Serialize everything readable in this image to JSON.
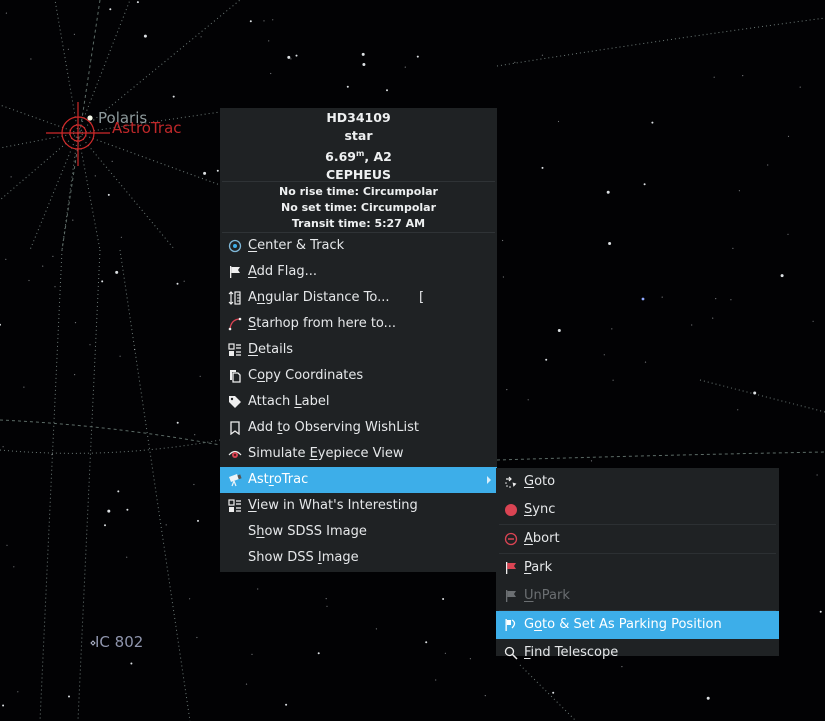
{
  "sky": {
    "labels": {
      "polaris": "Polaris",
      "telescope": "AstroTrac",
      "ic802": "IC 802"
    },
    "colors": {
      "background": "#020204",
      "telescope_reticle": "#d02a2a",
      "grid_lines": "#6e7b78",
      "stars": "#e8ecef"
    }
  },
  "context_menu": {
    "object_info": {
      "name": "HD34109",
      "type": "star",
      "magnitude": "6.69",
      "magnitude_unit": "m",
      "spectral": ", A2",
      "constellation": "CEPHEUS",
      "rise": "No rise time: Circumpolar",
      "set": "No set time: Circumpolar",
      "transit": "Transit time: 5:27 AM"
    },
    "items": [
      {
        "pre": "",
        "ul": "C",
        "post": "enter & Track",
        "icon": "center-track-icon"
      },
      {
        "pre": "",
        "ul": "A",
        "post": "dd Flag...",
        "icon": "flag-icon"
      },
      {
        "pre": "A",
        "ul": "n",
        "post": "gular Distance To...",
        "icon": "angular-distance-icon",
        "shortcut": "["
      },
      {
        "pre": "",
        "ul": "S",
        "post": "tarhop from here to...",
        "icon": "starhop-icon"
      },
      {
        "pre": "",
        "ul": "D",
        "post": "etails",
        "icon": "details-icon"
      },
      {
        "pre": "C",
        "ul": "o",
        "post": "py Coordinates",
        "icon": "copy-icon"
      },
      {
        "pre": "Attach ",
        "ul": "L",
        "post": "abel",
        "icon": "label-tag-icon"
      },
      {
        "pre": "Add ",
        "ul": "t",
        "post": "o Observing WishList",
        "icon": "bookmark-icon"
      },
      {
        "pre": "Simulate ",
        "ul": "E",
        "post": "yepiece View",
        "icon": "eye-icon"
      },
      {
        "pre": "Ast",
        "ul": "r",
        "post": "oTrac",
        "icon": "telescope-icon",
        "active": true,
        "submenu": true
      },
      {
        "pre": "",
        "ul": "V",
        "post": "iew in What's Interesting",
        "icon": "whats-interesting-icon"
      },
      {
        "pre": "S",
        "ul": "h",
        "post": "ow SDSS Image",
        "icon": ""
      },
      {
        "pre": "Show DSS ",
        "ul": "I",
        "post": "mage",
        "icon": ""
      }
    ]
  },
  "submenu": {
    "items": [
      {
        "pre": "",
        "ul": "G",
        "post": "oto",
        "icon": "goto-icon"
      },
      {
        "pre": "",
        "ul": "S",
        "post": "ync",
        "icon": "sync-icon"
      },
      {
        "pre": "",
        "ul": "A",
        "post": "bort",
        "icon": "abort-icon"
      },
      {
        "pre": "",
        "ul": "P",
        "post": "ark",
        "icon": "park-flag-icon"
      },
      {
        "pre": "",
        "ul": "U",
        "post": "nPark",
        "icon": "unpark-flag-icon",
        "disabled": true
      },
      {
        "pre": "G",
        "ul": "o",
        "post": "to & Set As Parking Position",
        "icon": "set-parking-icon",
        "active": true
      },
      {
        "pre": "",
        "ul": "F",
        "post": "ind Telescope",
        "icon": "find-telescope-icon"
      }
    ]
  },
  "colors": {
    "menu_bg": "#1f2224",
    "highlight": "#3daee9",
    "text": "#e6e8ea",
    "disabled_text": "#6b6f72",
    "danger_red": "#da4453"
  }
}
